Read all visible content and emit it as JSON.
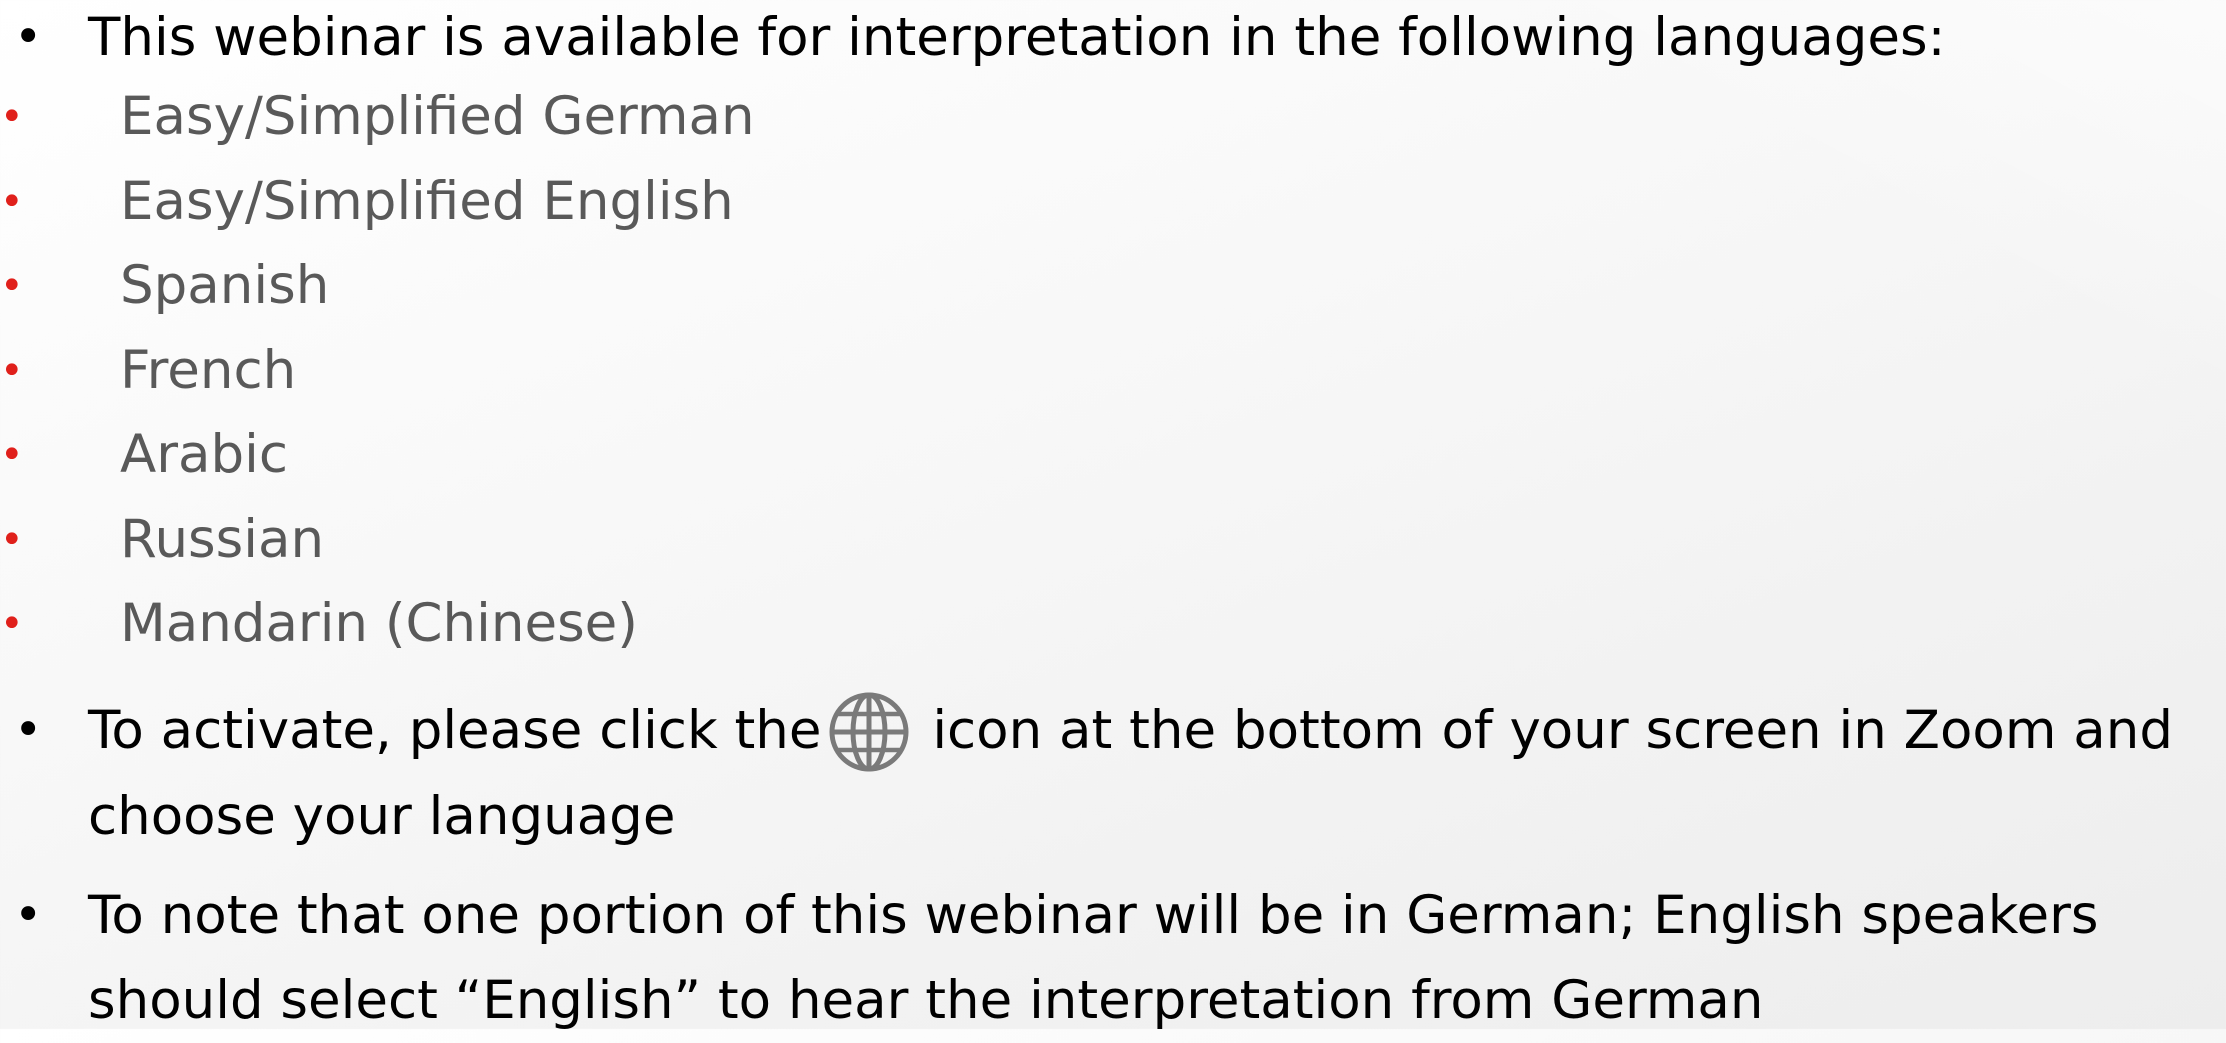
{
  "bullets": [
    {
      "text": "This webinar is available for interpretation in the following languages:",
      "languages": [
        "Easy/Simplified German",
        "Easy/Simplified English",
        "Spanish",
        "French",
        "Arabic",
        "Russian",
        "Mandarin (Chinese)"
      ]
    },
    {
      "text_before_icon": "To activate, please click the",
      "icon": "globe-icon",
      "text_after_icon": " icon at the bottom of your screen in Zoom and choose your language"
    },
    {
      "text": "To note that one portion of this webinar will be in German; English speakers should select “English” to hear the interpretation from German"
    }
  ],
  "colors": {
    "text": "#000000",
    "sub_text": "#595959",
    "sub_bullet": "#e0201b",
    "icon": "#7a7a7a"
  }
}
